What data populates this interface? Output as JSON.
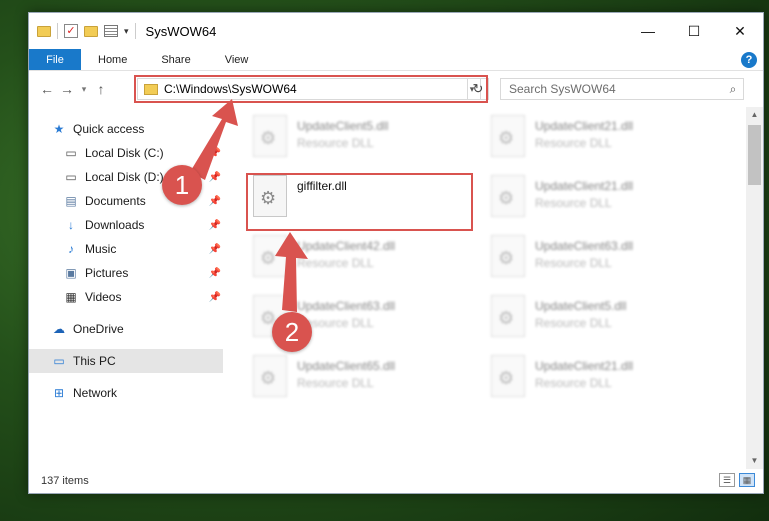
{
  "window": {
    "title": "SysWOW64",
    "controls": {
      "minimize": "—",
      "maximize": "☐",
      "close": "✕"
    }
  },
  "ribbon": {
    "tabs": [
      "File",
      "Home",
      "Share",
      "View"
    ],
    "help": "?"
  },
  "nav": {
    "back": "←",
    "forward": "→",
    "recent": "▾",
    "up": "↑",
    "address": "C:\\Windows\\SysWOW64",
    "refresh": "↻",
    "search_placeholder": "Search SysWOW64"
  },
  "sidebar": {
    "items": [
      {
        "label": "Quick access",
        "icon": "star-icon"
      },
      {
        "label": "Local Disk (C:)",
        "icon": "drive-icon",
        "pinned": true
      },
      {
        "label": "Local Disk (D:)",
        "icon": "drive-icon",
        "pinned": true
      },
      {
        "label": "Documents",
        "icon": "documents-icon",
        "pinned": true
      },
      {
        "label": "Downloads",
        "icon": "download-icon",
        "pinned": true
      },
      {
        "label": "Music",
        "icon": "music-icon",
        "pinned": true
      },
      {
        "label": "Pictures",
        "icon": "pictures-icon",
        "pinned": true
      },
      {
        "label": "Videos",
        "icon": "videos-icon",
        "pinned": true
      },
      {
        "label": "OneDrive",
        "icon": "cloud-icon"
      },
      {
        "label": "This PC",
        "icon": "computer-icon",
        "selected": true
      },
      {
        "label": "Network",
        "icon": "network-icon"
      }
    ]
  },
  "files": [
    {
      "name": "UpdateClient5.dll",
      "type": "Resource DLL"
    },
    {
      "name": "UpdateClient21.dll",
      "type": "Resource DLL"
    },
    {
      "name": "giffilter.dll",
      "type": ""
    },
    {
      "name": "UpdateClient21.dll",
      "type": "Resource DLL"
    },
    {
      "name": "UpdateClient42.dll",
      "type": "Resource DLL"
    },
    {
      "name": "UpdateClient63.dll",
      "type": "Resource DLL"
    },
    {
      "name": "UpdateClient63.dll",
      "type": "Resource DLL"
    },
    {
      "name": "UpdateClient5.dll",
      "type": "Resource DLL"
    },
    {
      "name": "UpdateClient65.dll",
      "type": "Resource DLL"
    },
    {
      "name": "UpdateClient21.dll",
      "type": "Resource DLL"
    }
  ],
  "status": {
    "item_count": "137 items"
  },
  "callouts": [
    "1",
    "2"
  ],
  "colors": {
    "accent": "#1979ca",
    "highlight": "#d9534f"
  }
}
